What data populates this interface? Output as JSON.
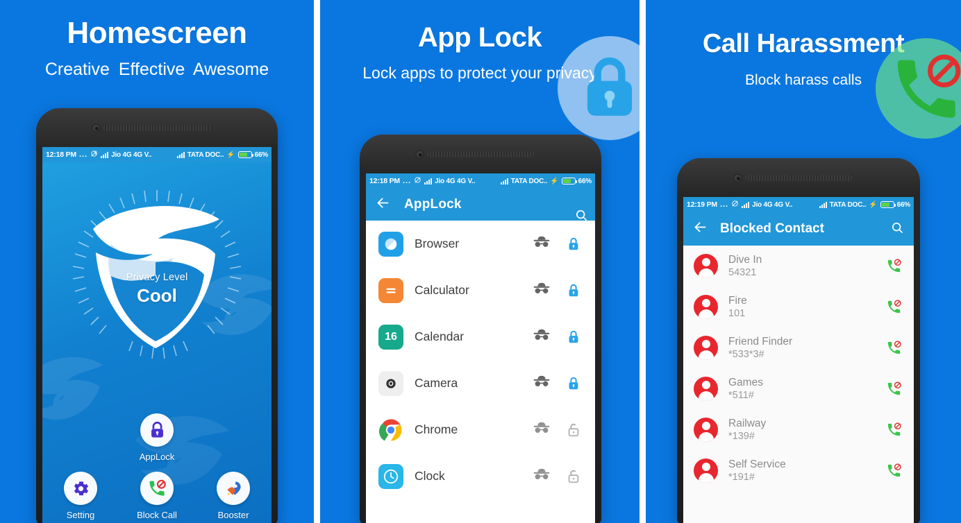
{
  "panels": [
    {
      "id": "homescreen",
      "title": "Homescreen",
      "subtitle": "Creative  Effective  Awesome",
      "statusbar": {
        "time": "12:18 PM",
        "dots": "...",
        "carrier1": "Jio 4G 4G V..",
        "carrier2": "TATA DOC..",
        "battery": "66%"
      },
      "shield": {
        "privacy_label": "Privacy Level",
        "privacy_value": "Cool"
      },
      "apps": [
        {
          "label": "AppLock",
          "icon": "lock-icon"
        },
        {
          "label": "Setting",
          "icon": "gear-icon"
        },
        {
          "label": "Block Call",
          "icon": "call-block-icon"
        },
        {
          "label": "Booster",
          "icon": "rocket-icon"
        }
      ]
    },
    {
      "id": "applock",
      "title": "App Lock",
      "subtitle": "Lock apps to protect your privacy",
      "statusbar": {
        "time": "12:18 PM",
        "dots": "...",
        "carrier1": "Jio 4G 4G V..",
        "carrier2": "TATA DOC..",
        "battery": "66%"
      },
      "appbar": {
        "title": "AppLock",
        "back_icon": "back-arrow-icon",
        "search_icon": "search-icon"
      },
      "apps": [
        {
          "name": "Browser",
          "icon": "browser-icon",
          "locked": true
        },
        {
          "name": "Calculator",
          "icon": "calculator-icon",
          "locked": true
        },
        {
          "name": "Calendar",
          "icon": "calendar-icon",
          "locked": true
        },
        {
          "name": "Camera",
          "icon": "camera-icon",
          "locked": true
        },
        {
          "name": "Chrome",
          "icon": "chrome-icon",
          "locked": false
        },
        {
          "name": "Clock",
          "icon": "clock-icon",
          "locked": false
        }
      ],
      "overlay_icon": "padlock-icon"
    },
    {
      "id": "callharassment",
      "title": "Call Harassment",
      "subtitle": "Block harass calls",
      "statusbar": {
        "time": "12:19 PM",
        "dots": "...",
        "carrier1": "Jio 4G 4G V..",
        "carrier2": "TATA DOC..",
        "battery": "66%"
      },
      "appbar": {
        "title": "Blocked Contact",
        "back_icon": "back-arrow-icon",
        "search_icon": "search-icon"
      },
      "contacts": [
        {
          "name": "Dive In",
          "number": "54321"
        },
        {
          "name": "Fire",
          "number": "101"
        },
        {
          "name": "Friend Finder",
          "number": "*533*3#"
        },
        {
          "name": "Games",
          "number": "*511#"
        },
        {
          "name": "Railway",
          "number": "*139#"
        },
        {
          "name": "Self Service",
          "number": "*191#"
        }
      ],
      "overlay_icon": "blocked-call-icon"
    }
  ],
  "colors": {
    "background_blue": "#0a77e0",
    "statusbar_blue": "#2196d8",
    "lock_blue": "#29a3e8",
    "avatar_red": "#e8262e",
    "call_green": "#3dc44c"
  }
}
